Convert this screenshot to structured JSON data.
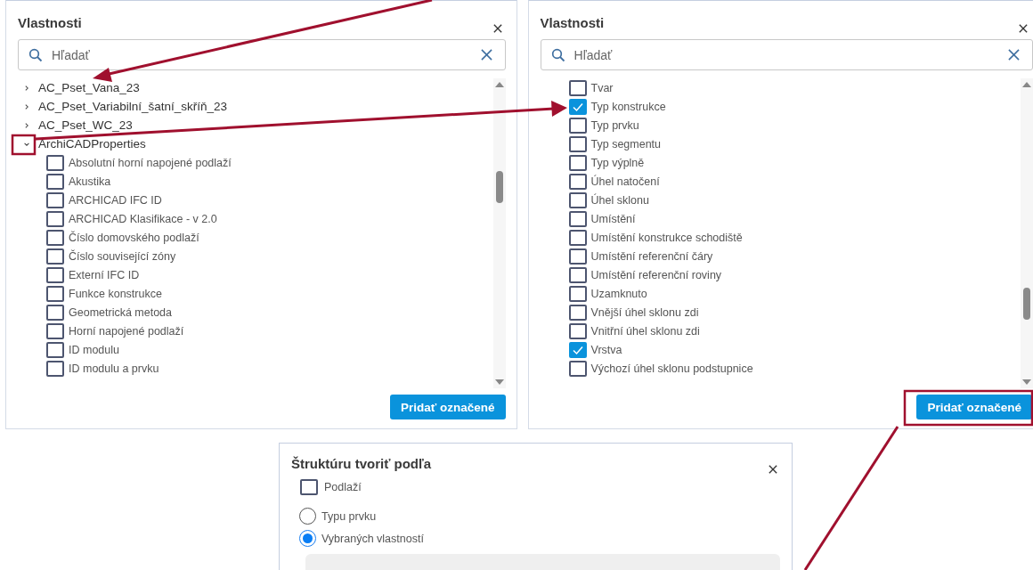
{
  "panels": [
    {
      "title": "Vlastnosti",
      "search": {
        "placeholder": "Hľadať"
      },
      "items": [
        {
          "kind": "group",
          "label": "AC_Pset_Vana_23",
          "expanded": false
        },
        {
          "kind": "group",
          "label": "AC_Pset_Variabilní_šatní_skříň_23",
          "expanded": false
        },
        {
          "kind": "group",
          "label": "AC_Pset_WC_23",
          "expanded": false
        },
        {
          "kind": "group",
          "label": "ArchiCADProperties",
          "expanded": true,
          "children": [
            {
              "label": "Absolutní horní napojené podlaží",
              "checked": false
            },
            {
              "label": "Akustika",
              "checked": false
            },
            {
              "label": "ARCHICAD IFC ID",
              "checked": false
            },
            {
              "label": "ARCHICAD Klasifikace - v 2.0",
              "checked": false
            },
            {
              "label": "Číslo domovského podlaží",
              "checked": false
            },
            {
              "label": "Číslo související zóny",
              "checked": false
            },
            {
              "label": "Externí IFC ID",
              "checked": false
            },
            {
              "label": "Funkce konstrukce",
              "checked": false
            },
            {
              "label": "Geometrická metoda",
              "checked": false
            },
            {
              "label": "Horní napojené podlaží",
              "checked": false
            },
            {
              "label": "ID modulu",
              "checked": false
            },
            {
              "label": "ID modulu a prvku",
              "checked": false
            }
          ]
        }
      ],
      "button": "Pridať označené"
    },
    {
      "title": "Vlastnosti",
      "search": {
        "placeholder": "Hľadať"
      },
      "items": [
        {
          "kind": "option",
          "label": "Tvar",
          "checked": false
        },
        {
          "kind": "option",
          "label": "Typ konstrukce",
          "checked": true
        },
        {
          "kind": "option",
          "label": "Typ prvku",
          "checked": false
        },
        {
          "kind": "option",
          "label": "Typ segmentu",
          "checked": false
        },
        {
          "kind": "option",
          "label": "Typ výplně",
          "checked": false
        },
        {
          "kind": "option",
          "label": "Úhel natočení",
          "checked": false
        },
        {
          "kind": "option",
          "label": "Úhel sklonu",
          "checked": false
        },
        {
          "kind": "option",
          "label": "Umístění",
          "checked": false
        },
        {
          "kind": "option",
          "label": "Umístění konstrukce schodiště",
          "checked": false
        },
        {
          "kind": "option",
          "label": "Umístění referenční čáry",
          "checked": false
        },
        {
          "kind": "option",
          "label": "Umístění referenční roviny",
          "checked": false
        },
        {
          "kind": "option",
          "label": "Uzamknuto",
          "checked": false
        },
        {
          "kind": "option",
          "label": "Vnější úhel sklonu zdi",
          "checked": false
        },
        {
          "kind": "option",
          "label": "Vnitřní úhel sklonu zdi",
          "checked": false
        },
        {
          "kind": "option",
          "label": "Vrstva",
          "checked": true
        },
        {
          "kind": "option",
          "label": "Výchozí úhel sklonu podstupnice",
          "checked": false
        }
      ],
      "button": "Pridať označené"
    }
  ],
  "structure": {
    "title": "Štruktúru tvoriť podľa",
    "checkbox": {
      "label": "Podlaží",
      "checked": false
    },
    "radios": [
      {
        "label": "Typu prvku",
        "selected": false
      },
      {
        "label": "Vybraných vlastností",
        "selected": true
      }
    ]
  }
}
